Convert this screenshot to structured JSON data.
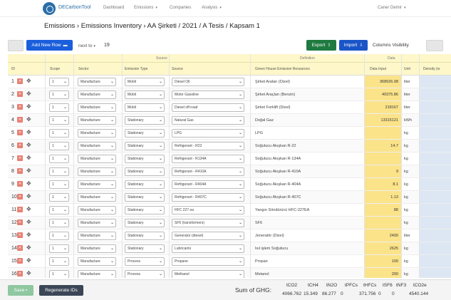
{
  "nav": {
    "brand": "DECarbonTool",
    "items": [
      "Dashboard",
      "Emissions",
      "Companies",
      "Analysis"
    ],
    "user": "Caner Demir"
  },
  "breadcrumb": "Emissions › Emissions Inventory › AA Şirketi / 2021 / A Tesis / Kapsam 1",
  "toolbar": {
    "add_new_row": "Add New Row",
    "next_to": "next to",
    "next_to_value": "19",
    "export": "Export",
    "import": "Import",
    "columns_visibility": "Columns Visibility"
  },
  "groups": {
    "source": "Source",
    "definition": "Definition",
    "data": "Data"
  },
  "columns": [
    "ID",
    "Scope",
    "Sector",
    "Emission Type",
    "Source",
    "Green House Emission Resources",
    "Data Input",
    "Unit",
    "Density (w"
  ],
  "rows": [
    {
      "id": "1",
      "scope": "1",
      "sector": "Manufacture",
      "type": "Mobil",
      "source": "Diesel Oil",
      "resource": "Şirket Araları (Dizel)",
      "data": "368926.98",
      "unit": "liter"
    },
    {
      "id": "2",
      "scope": "1",
      "sector": "Manufacture",
      "type": "Mobil",
      "source": "Motor Gasoline",
      "resource": "Şirket Araçları (Benzin)",
      "data": "40375.86",
      "unit": "liter"
    },
    {
      "id": "3",
      "scope": "1",
      "sector": "Manufacture",
      "type": "Mobil",
      "source": "Diesel off-road",
      "resource": "Şirket Forklift (Dizel)",
      "data": "218167",
      "unit": "liter"
    },
    {
      "id": "4",
      "scope": "1",
      "sector": "Manufacture",
      "type": "Stationary",
      "source": "Natural Gas",
      "resource": "Doğal Gaz",
      "data": "13315121",
      "unit": "kWh"
    },
    {
      "id": "5",
      "scope": "1",
      "sector": "Manufacture",
      "type": "Stationary",
      "source": "LPG",
      "resource": "LPG",
      "data": "",
      "unit": "kg"
    },
    {
      "id": "6",
      "scope": "1",
      "sector": "Manufacture",
      "type": "Stationary",
      "source": "Refrigerant - R22",
      "resource": "Soğutucu Akışkan R-22",
      "data": "14.7",
      "unit": "kg"
    },
    {
      "id": "7",
      "scope": "1",
      "sector": "Manufacture",
      "type": "Stationary",
      "source": "Refrigerant - R134A",
      "resource": "Soğutucu Akışkan R-134A",
      "data": "",
      "unit": "kg"
    },
    {
      "id": "8",
      "scope": "1",
      "sector": "Manufacture",
      "type": "Stationary",
      "source": "Refrigerant - R410A",
      "resource": "Soğutucu Akışkan R-410A",
      "data": "9",
      "unit": "kg"
    },
    {
      "id": "9",
      "scope": "1",
      "sector": "Manufacture",
      "type": "Stationary",
      "source": "Refrigerant - R404A",
      "resource": "Soğutucu Akışkan R-404A",
      "data": "8.1",
      "unit": "kg"
    },
    {
      "id": "10",
      "scope": "1",
      "sector": "Manufacture",
      "type": "Stationary",
      "source": "Refrigerant - R407C",
      "resource": "Soğutucu Akışkan R-407C",
      "data": "1.13",
      "unit": "kg"
    },
    {
      "id": "11",
      "scope": "1",
      "sector": "Manufacture",
      "type": "Stationary",
      "source": "HFC 227 ea",
      "resource": "Yangın Söndürücü HFC-227EA",
      "data": "88",
      "unit": "kg"
    },
    {
      "id": "12",
      "scope": "1",
      "sector": "Manufacture",
      "type": "Stationary",
      "source": "SF6 (transformers)",
      "resource": "SF6",
      "data": "",
      "unit": "kg"
    },
    {
      "id": "13",
      "scope": "1",
      "sector": "Manufacture",
      "type": "Stationary",
      "source": "Generator (diesel)",
      "resource": "Jeneratör (Dizel)",
      "data": "2400",
      "unit": "liter"
    },
    {
      "id": "14",
      "scope": "1",
      "sector": "Manufacture",
      "type": "Stationary",
      "source": "Lubricants",
      "resource": "Isıl işlem Soğutucu",
      "data": "2625",
      "unit": "kg"
    },
    {
      "id": "15",
      "scope": "1",
      "sector": "Manufacture",
      "type": "Process",
      "source": "Propane",
      "resource": "Propan",
      "data": "100",
      "unit": "kg"
    },
    {
      "id": "16",
      "scope": "1",
      "sector": "Manufacture",
      "type": "Process",
      "source": "Methanol",
      "resource": "Metanol",
      "data": "200",
      "unit": "kg"
    }
  ],
  "footer": {
    "save": "Save",
    "regenerate": "Regenerate IDs",
    "sum_label": "Sum of GHG:",
    "headers": [
      "tCO2",
      "tCH4",
      "tN2O",
      "tPFCs",
      "tHFCs",
      "tSF6",
      "tNF3",
      "tCO2e"
    ],
    "values": [
      "4066.762",
      "15.349",
      "86.277",
      "0",
      "371.756",
      "0",
      "0",
      "4540.144"
    ]
  }
}
